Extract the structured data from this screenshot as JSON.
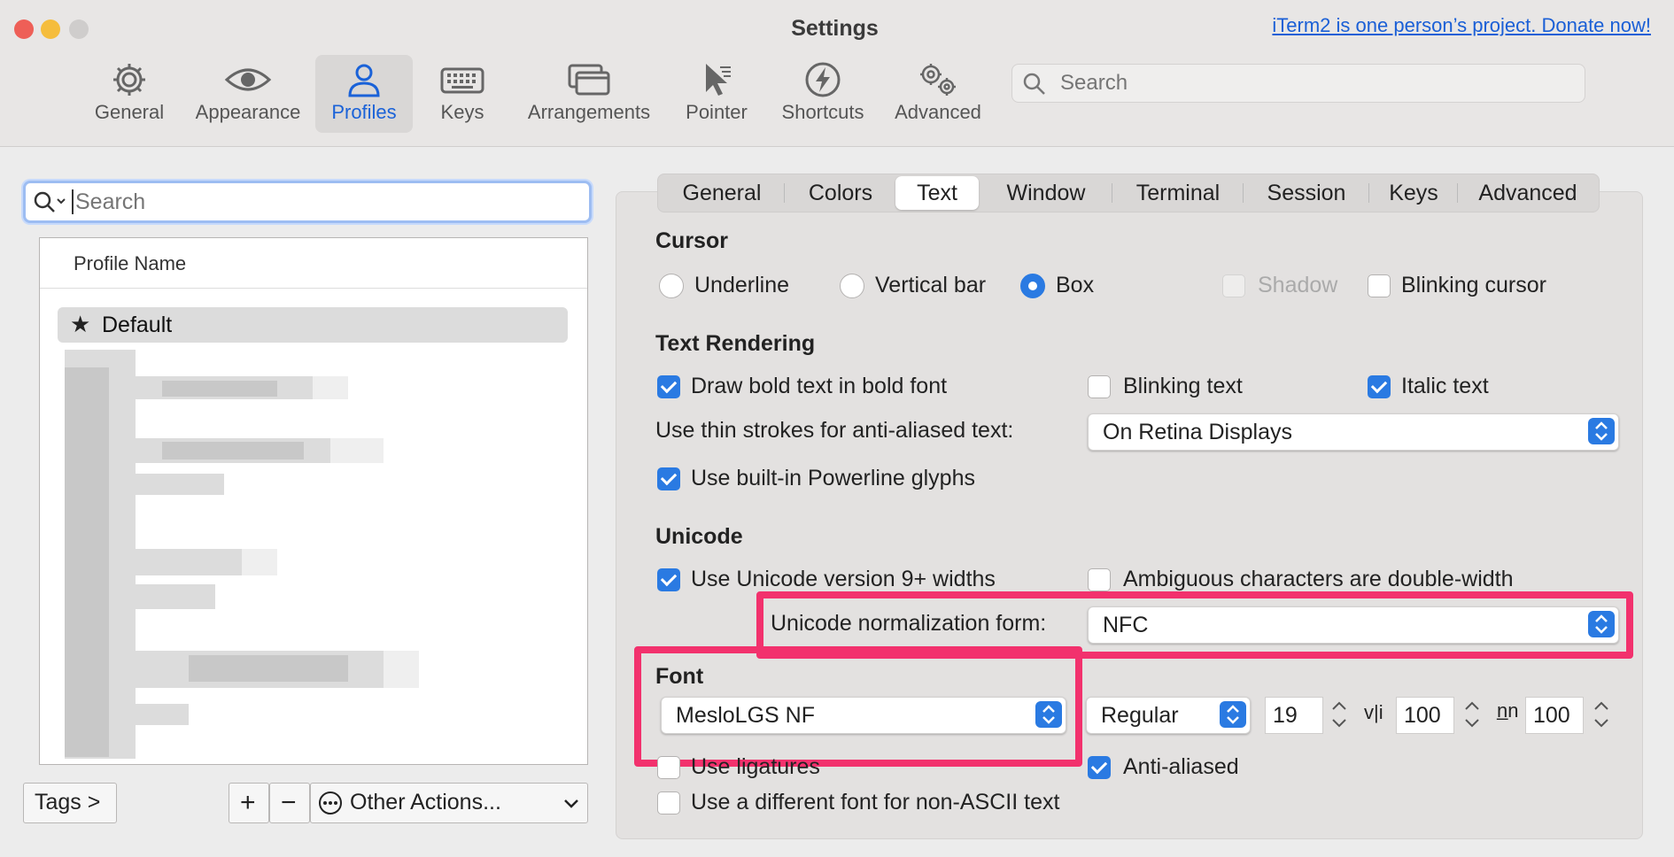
{
  "window": {
    "title": "Settings",
    "donate_link": "iTerm2 is one person’s project. Donate now!"
  },
  "toolbar": {
    "items": [
      {
        "label": "General",
        "icon": "gear-icon"
      },
      {
        "label": "Appearance",
        "icon": "eye-icon"
      },
      {
        "label": "Profiles",
        "icon": "person-icon",
        "selected": true
      },
      {
        "label": "Keys",
        "icon": "keyboard-icon"
      },
      {
        "label": "Arrangements",
        "icon": "windows-icon"
      },
      {
        "label": "Pointer",
        "icon": "pointer-icon"
      },
      {
        "label": "Shortcuts",
        "icon": "bolt-icon"
      },
      {
        "label": "Advanced",
        "icon": "gears-icon"
      }
    ],
    "search_placeholder": "Search",
    "accent_color": "#1a62d8"
  },
  "profiles": {
    "search_placeholder": "Search",
    "column_header": "Profile Name",
    "items": [
      {
        "name": "Default",
        "star": "★",
        "selected": true
      }
    ],
    "tags_button": "Tags >",
    "add_button": "+",
    "remove_button": "−",
    "other_actions": "Other Actions..."
  },
  "tabs": [
    "General",
    "Colors",
    "Text",
    "Window",
    "Terminal",
    "Session",
    "Keys",
    "Advanced"
  ],
  "selected_tab": "Text",
  "cursor": {
    "heading": "Cursor",
    "underline": "Underline",
    "vertical_bar": "Vertical bar",
    "box": "Box",
    "shadow": "Shadow",
    "blinking": "Blinking cursor"
  },
  "text_rendering": {
    "heading": "Text Rendering",
    "bold": "Draw bold text in bold font",
    "blinking_text": "Blinking text",
    "italic": "Italic text",
    "thin_strokes_label": "Use thin strokes for anti-aliased text:",
    "thin_strokes_value": "On Retina Displays",
    "powerline": "Use built-in Powerline glyphs"
  },
  "unicode": {
    "heading": "Unicode",
    "widths": "Use Unicode version 9+ widths",
    "ambiguous": "Ambiguous characters are double-width",
    "normalization_label": "Unicode normalization form:",
    "normalization_value": "NFC"
  },
  "font": {
    "heading": "Font",
    "family": "MesloLGS NF",
    "weight": "Regular",
    "size": "19",
    "vli_glyph": "v|i",
    "horizontal_spacing": "100",
    "nn_glyph": "n̲n",
    "vertical_spacing": "100",
    "ligatures": "Use ligatures",
    "antialiased": "Anti-aliased",
    "non_ascii": "Use a different font for non-ASCII text"
  },
  "colors": {
    "highlight": "#f2316d",
    "checkbox_blue": "#2a7ae2"
  }
}
